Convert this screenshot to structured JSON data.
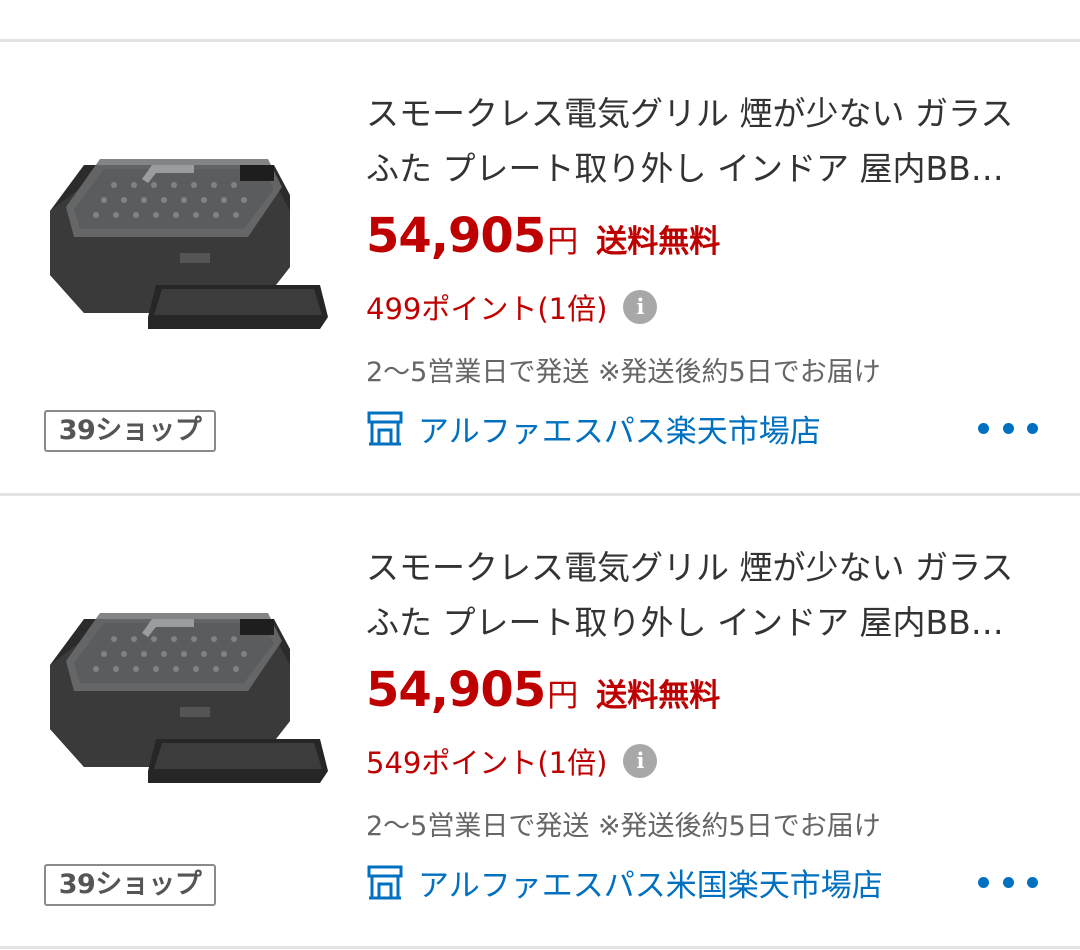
{
  "colors": {
    "price": "#bf0000",
    "link": "#0070c0",
    "divider": "#e3e3e3"
  },
  "products": [
    {
      "title_line1": "スモークレス電気グリル 煙が少ない ガラス",
      "title_line2": "ふた プレート取り外し インドア 屋内BB…",
      "price": "54,905",
      "currency": "円",
      "shipping": "送料無料",
      "points": "499ポイント(1倍)",
      "info_icon": "i",
      "delivery": "2〜5営業日で発送 ※発送後約5日でお届け",
      "shop_badge": "39ショップ",
      "shop_icon": "store-icon",
      "shop_name": "アルファエスパス楽天市場店"
    },
    {
      "title_line1": "スモークレス電気グリル 煙が少ない ガラス",
      "title_line2": "ふた プレート取り外し インドア 屋内BB…",
      "price": "54,905",
      "currency": "円",
      "shipping": "送料無料",
      "points": "549ポイント(1倍)",
      "info_icon": "i",
      "delivery": "2〜5営業日で発送 ※発送後約5日でお届け",
      "shop_badge": "39ショップ",
      "shop_icon": "store-icon",
      "shop_name": "アルファエスパス米国楽天市場店"
    }
  ]
}
